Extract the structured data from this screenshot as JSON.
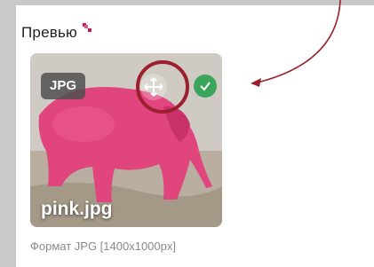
{
  "panel": {
    "title": "Превью",
    "format_caption": "Формат JPG [1400x1000px]"
  },
  "preview": {
    "badge": "JPG",
    "filename": "pink.jpg",
    "move_icon": "move-arrows-icon",
    "check_icon": "check-icon"
  },
  "colors": {
    "accent": "#c2185b",
    "success": "#3aa55a",
    "highlight": "#9c1f2e",
    "elephant": "#e0457e"
  }
}
